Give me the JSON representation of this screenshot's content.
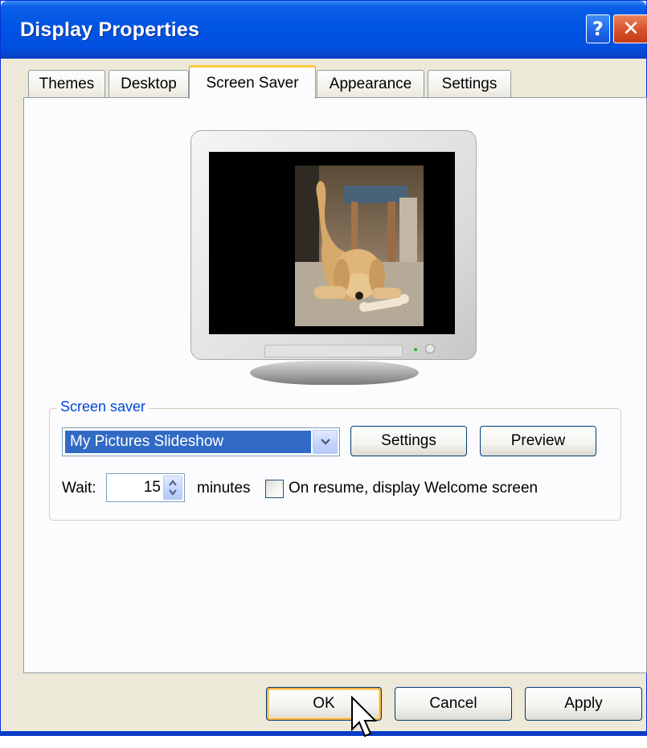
{
  "window": {
    "title": "Display Properties",
    "help_glyph": "?",
    "close_glyph": "✕"
  },
  "tabs": [
    {
      "label": "Themes",
      "active": false
    },
    {
      "label": "Desktop",
      "active": false
    },
    {
      "label": "Screen Saver",
      "active": true
    },
    {
      "label": "Appearance",
      "active": false
    },
    {
      "label": "Settings",
      "active": false
    }
  ],
  "preview": {
    "image": "puppy-with-bone-photo"
  },
  "screensaver_group": {
    "label": "Screen saver",
    "selected": "My Pictures Slideshow",
    "settings_button": "Settings",
    "preview_button": "Preview",
    "wait_label": "Wait:",
    "wait_value": "15",
    "minutes_label": "minutes",
    "resume_checkbox_label": "On resume, display Welcome screen",
    "resume_checked": false
  },
  "footer": {
    "ok": "OK",
    "cancel": "Cancel",
    "apply": "Apply"
  },
  "colors": {
    "title_blue": "#0054e3",
    "selection_blue": "#316ac5",
    "group_label": "#0046d5",
    "tab_highlight": "#ffc83c"
  }
}
